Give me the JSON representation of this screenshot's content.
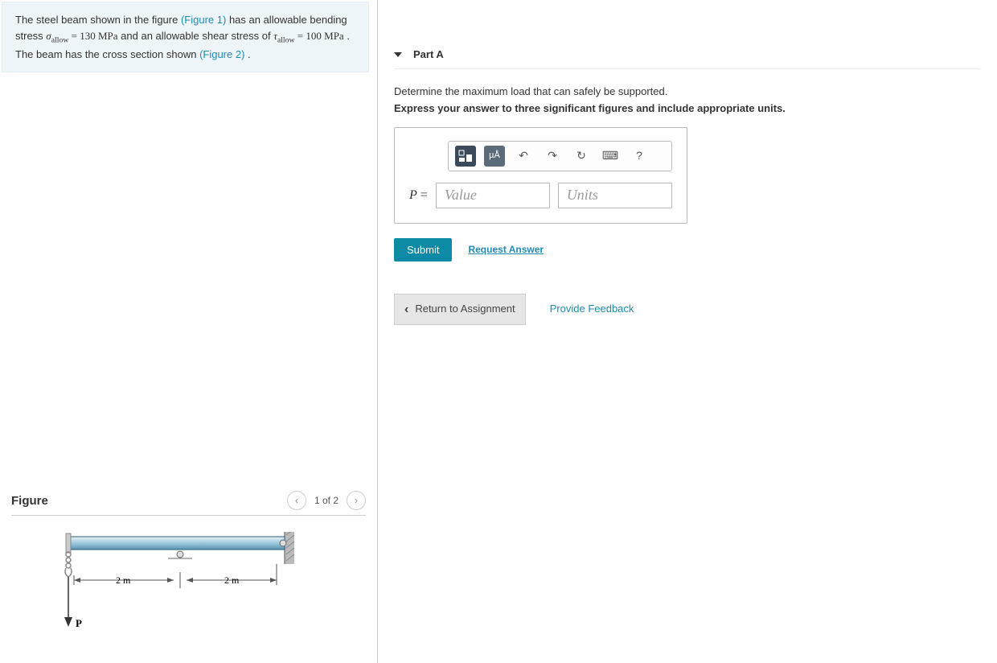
{
  "problem": {
    "text_prefix": "The steel beam shown in the figure ",
    "figure1_link": "(Figure 1)",
    "text_mid1": " has an allowable bending stress ",
    "sigma_label": "σ",
    "sigma_sub": "allow",
    "sigma_val": " = 130 MPa",
    "text_mid2": " and an allowable shear stress of ",
    "tau_label": "τ",
    "tau_sub": "allow",
    "tau_val": " = 100 MPa",
    "text_mid3": " . The beam has the cross section shown ",
    "figure2_link": "(Figure 2)",
    "text_end": "."
  },
  "figure": {
    "title": "Figure",
    "pager": "1 of 2",
    "dim_left": "2 m",
    "dim_right": "2 m",
    "load_label": "P"
  },
  "part": {
    "title": "Part A",
    "question": "Determine the maximum load that can safely be supported.",
    "instruction": "Express your answer to three significant figures and include appropriate units.",
    "var": "P",
    "eq": "=",
    "value_placeholder": "Value",
    "units_placeholder": "Units",
    "toolbar": {
      "templates": "□",
      "symbols": "µÅ",
      "undo": "↶",
      "redo": "↷",
      "reset": "↻",
      "keyboard": "⌨",
      "help": "?"
    }
  },
  "actions": {
    "submit": "Submit",
    "request_answer": "Request Answer",
    "return": "Return to Assignment",
    "feedback": "Provide Feedback"
  }
}
